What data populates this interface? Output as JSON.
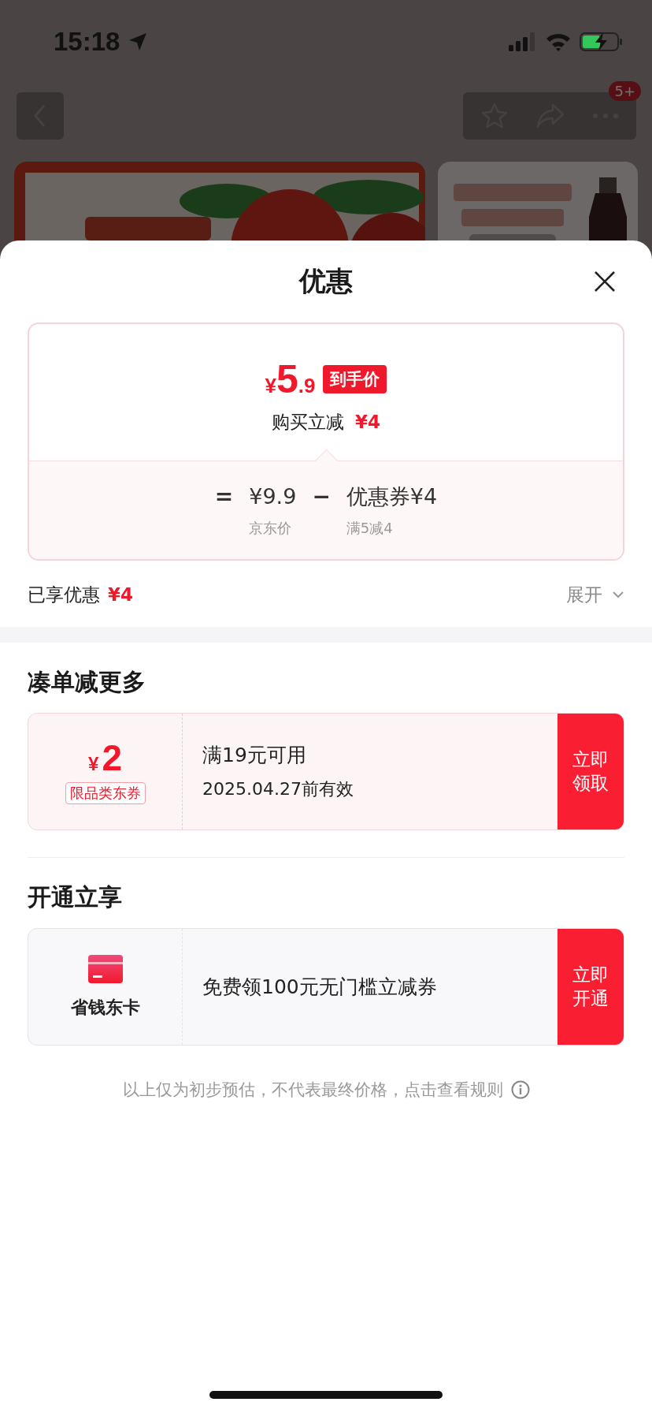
{
  "status_bar": {
    "time": "15:18"
  },
  "nav": {
    "badge": "5+"
  },
  "sheet": {
    "title": "优惠",
    "price_card": {
      "currency": "¥",
      "integer": "5",
      "decimal": ".9",
      "tag": "到手价",
      "saving_label": "购买立减",
      "saving_value": "¥4",
      "formula": [
        {
          "kind": "op",
          "text": "="
        },
        {
          "kind": "term",
          "value": "¥9.9",
          "caption": "京东价"
        },
        {
          "kind": "op",
          "text": "−"
        },
        {
          "kind": "term",
          "value": "优惠券¥4",
          "caption": "满5减4"
        }
      ]
    },
    "enjoyed": {
      "label": "已享优惠",
      "value": "¥4",
      "toggle": "展开"
    }
  },
  "sections": [
    {
      "title": "凑单减更多",
      "coupon": {
        "kind": "amount",
        "currency": "¥",
        "amount": "2",
        "tag": "限品类东券",
        "line1": "满19元可用",
        "line2": "2025.04.27前有效",
        "button": "立即领取"
      }
    },
    {
      "title": "开通立享",
      "coupon": {
        "kind": "card",
        "card_name": "省钱东卡",
        "line1": "免费领100元无门槛立减券",
        "button": "立即开通"
      }
    }
  ],
  "footnote": "以上仅为初步预估，不代表最终价格，点击查看规则"
}
